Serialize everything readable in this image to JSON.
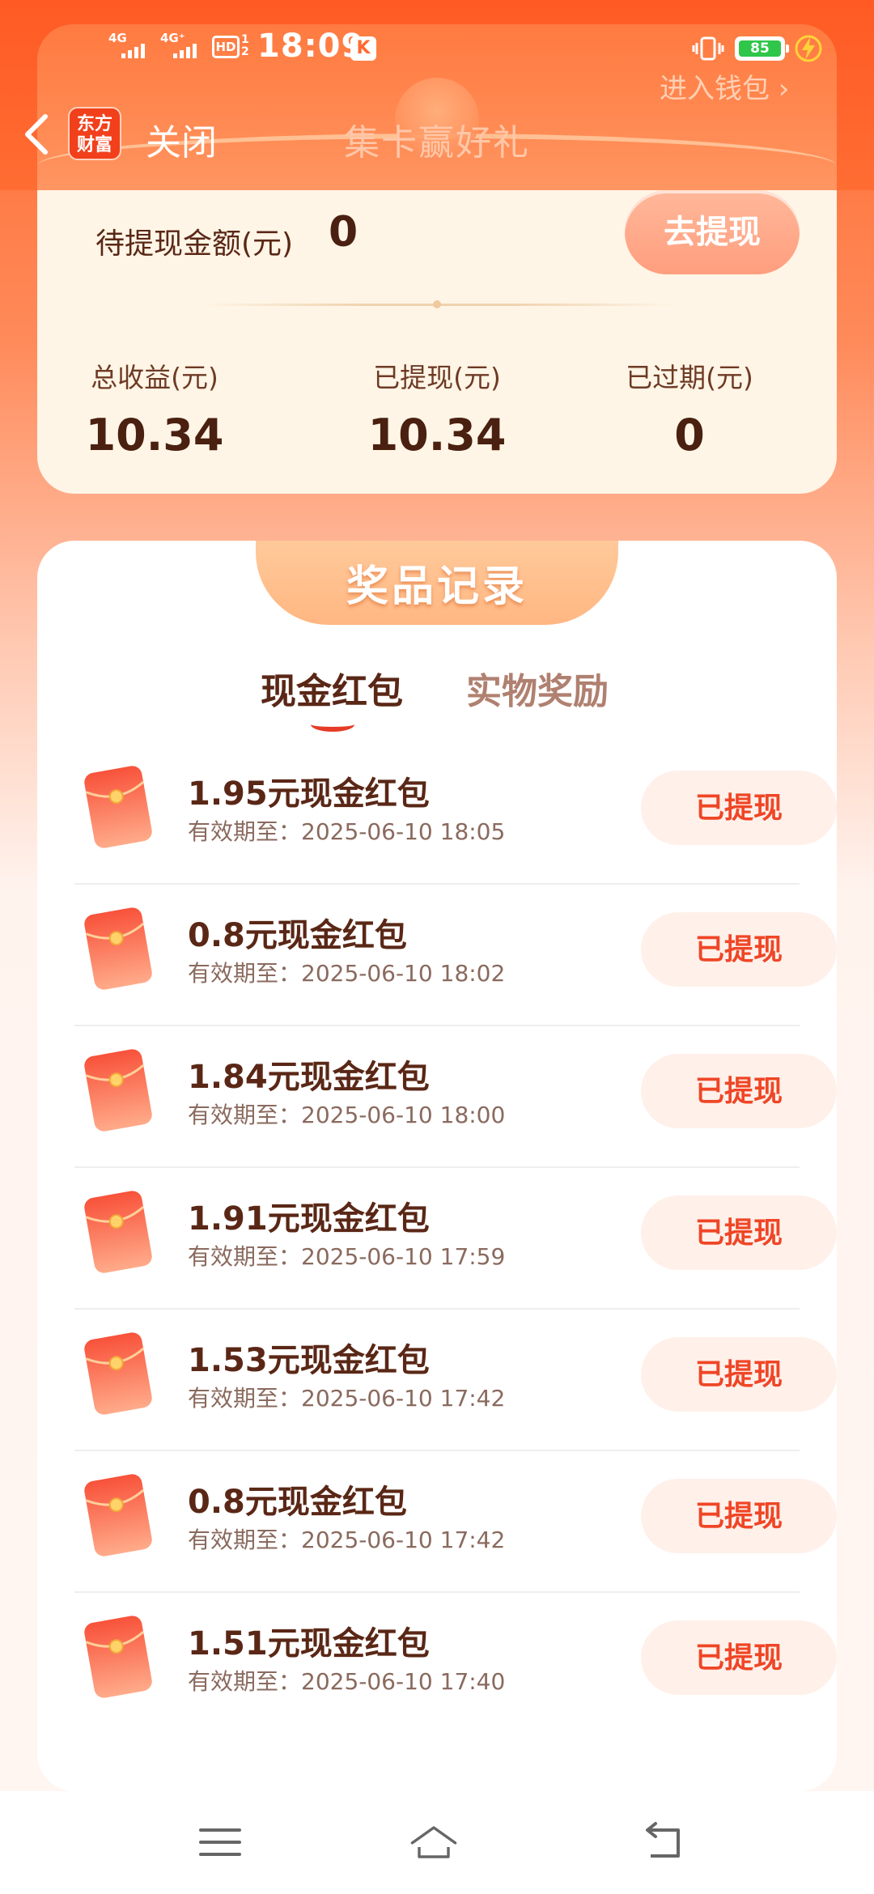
{
  "status_bar": {
    "time": "18:09",
    "signal1": "4G",
    "signal2": "4G⁺",
    "hd": "HD",
    "hd_slots": "1 2",
    "k": "K",
    "battery": "85"
  },
  "header": {
    "logo_text_line1": "东方",
    "logo_text_line2": "财富",
    "close_label": "关闭",
    "title": "集卡赢好礼",
    "wallet_link": "进入钱包 ›"
  },
  "summary": {
    "pending_label": "待提现金额(元)",
    "pending_value": "0",
    "withdraw_button": "去提现",
    "stats": [
      {
        "label": "总收益(元)",
        "value": "10.34"
      },
      {
        "label": "已提现(元)",
        "value": "10.34"
      },
      {
        "label": "已过期(元)",
        "value": "0"
      }
    ]
  },
  "records": {
    "title": "奖品记录",
    "tabs": [
      {
        "label": "现金红包",
        "active": true
      },
      {
        "label": "实物奖励",
        "active": false
      }
    ],
    "items": [
      {
        "title": "1.95元现金红包",
        "date": "有效期至：2025-06-10 18:05",
        "status": "已提现"
      },
      {
        "title": "0.8元现金红包",
        "date": "有效期至：2025-06-10 18:02",
        "status": "已提现"
      },
      {
        "title": "1.84元现金红包",
        "date": "有效期至：2025-06-10 18:00",
        "status": "已提现"
      },
      {
        "title": "1.91元现金红包",
        "date": "有效期至：2025-06-10 17:59",
        "status": "已提现"
      },
      {
        "title": "1.53元现金红包",
        "date": "有效期至：2025-06-10 17:42",
        "status": "已提现"
      },
      {
        "title": "0.8元现金红包",
        "date": "有效期至：2025-06-10 17:42",
        "status": "已提现"
      },
      {
        "title": "1.51元现金红包",
        "date": "有效期至：2025-06-10 17:40",
        "status": "已提现"
      }
    ]
  },
  "nav": {
    "icons": [
      "menu-icon",
      "home-icon",
      "back-icon"
    ]
  },
  "colors": {
    "brand_orange": "#ff5a24",
    "status_red": "#ef4626",
    "battery_green": "#2fc64a"
  }
}
